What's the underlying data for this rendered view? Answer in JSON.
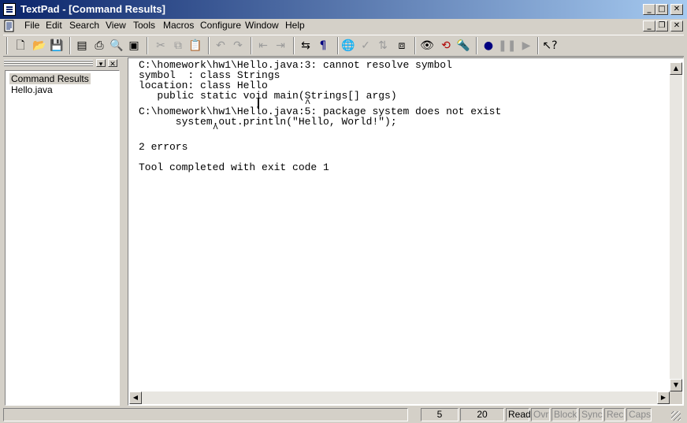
{
  "window": {
    "title": "TextPad - [Command Results]",
    "caption_buttons": [
      "minimize-icon",
      "maximize-icon",
      "close-icon"
    ],
    "mdi_buttons": [
      "minimize-icon",
      "restore-icon",
      "close-icon"
    ]
  },
  "menu": {
    "items": [
      "File",
      "Edit",
      "Search",
      "View",
      "Tools",
      "Macros",
      "Configure",
      "Window",
      "Help"
    ]
  },
  "toolbar": {
    "icons": [
      "new-file-icon",
      "open-folder-icon",
      "save-icon",
      "manage-files-icon",
      "print-icon",
      "print-preview-icon",
      "text-window-icon",
      "cut-icon",
      "copy-icon",
      "paste-icon",
      "undo-icon",
      "redo-icon",
      "decrease-indent-icon",
      "increase-indent-icon",
      "word-wrap-icon",
      "pilcrow-icon",
      "globe-icon",
      "spell-check-icon",
      "sort-icon",
      "compare-icon",
      "find-icon",
      "replace-icon",
      "find-in-files-icon",
      "record-macro-icon",
      "pause-macro-icon",
      "play-macro-icon",
      "context-help-icon"
    ]
  },
  "document_selector": {
    "items": [
      "Command Results",
      "Hello.java"
    ],
    "selected": "Command Results"
  },
  "output": {
    "lines": [
      "C:\\homework\\hw1\\Hello.java:3: cannot resolve symbol",
      "symbol  : class Strings",
      "location: class Hello",
      "   public static void main(Strings[] args)",
      "                           ^",
      "C:\\homework\\hw1\\Hello.java:5: package system does not exist",
      "      system.out.println(\"Hello, World!\");",
      "            ^",
      "",
      "2 errors",
      "",
      "Tool completed with exit code 1"
    ]
  },
  "statusbar": {
    "line": "5",
    "column": "20",
    "read": "Read",
    "ovr": "Ovr",
    "block": "Block",
    "sync": "Sync",
    "rec": "Rec",
    "caps": "Caps"
  }
}
